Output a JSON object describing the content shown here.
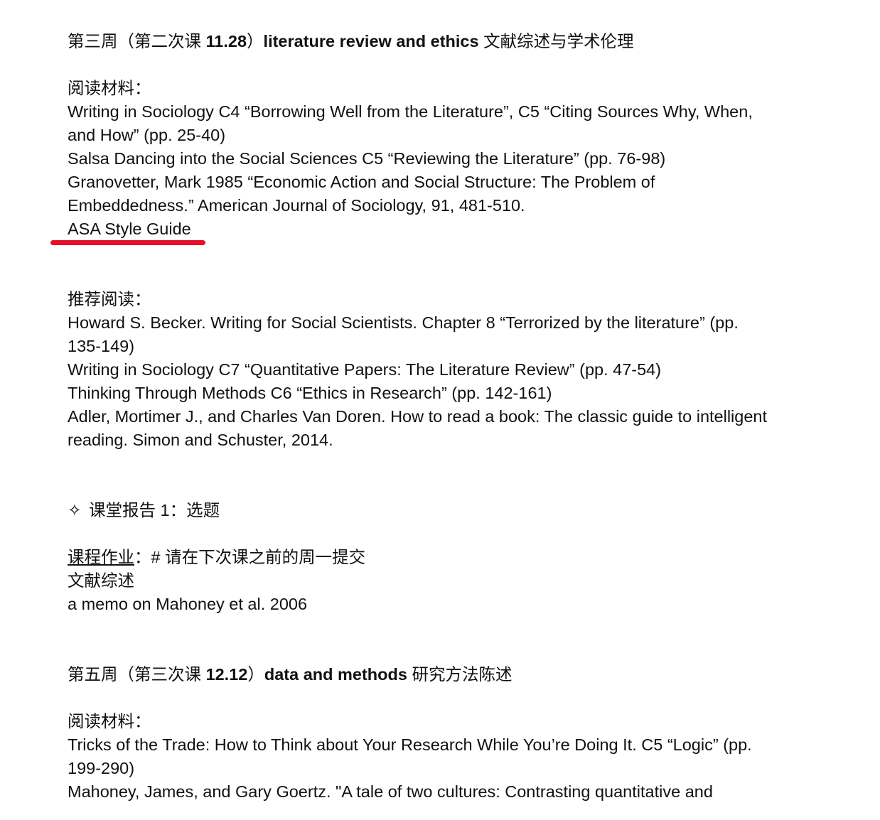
{
  "week3": {
    "title_prefix": "第三周（第二次课 ",
    "title_date": "11.28",
    "title_mid": "）",
    "title_en": "literature review and ethics",
    "title_cn": " 文献综述与学术伦理",
    "reading_label": "阅读材料：",
    "readings": [
      "Writing in Sociology C4 “Borrowing Well from the Literature”, C5 “Citing Sources Why, When,",
      "and How” (pp. 25-40)",
      "Salsa Dancing into the Social Sciences C5 “Reviewing the Literature” (pp. 76-98)",
      "Granovetter, Mark 1985 “Economic Action and Social Structure: The Problem of",
      "Embeddedness.” American Journal of Sociology, 91, 481-510."
    ],
    "highlighted_reading": "ASA Style Guide",
    "recommended_label": "推荐阅读：",
    "recommended": [
      "Howard S. Becker. Writing for Social Scientists. Chapter 8 “Terrorized by the literature” (pp.",
      "135-149)",
      "Writing in Sociology C7 “Quantitative Papers: The Literature Review” (pp. 47-54)",
      "Thinking Through Methods C6 “Ethics in Research” (pp. 142-161)",
      "Adler, Mortimer J., and Charles Van Doren. How to read a book: The classic guide to intelligent",
      "reading. Simon and Schuster, 2014."
    ],
    "report_bullet": "✧",
    "report_text": "课堂报告 1：选题",
    "homework_label": "课程作业",
    "homework_colon": "：",
    "homework_note": "# 请在下次课之前的周一提交",
    "homework_items": [
      "文献综述",
      "a memo on Mahoney et al. 2006"
    ]
  },
  "week5": {
    "title_prefix": "第五周（第三次课 ",
    "title_date": "12.12",
    "title_mid": "）",
    "title_en": "data and methods",
    "title_cn": " 研究方法陈述",
    "reading_label": "阅读材料：",
    "readings": [
      "Tricks of the Trade: How to Think about Your Research While You’re Doing It. C5 “Logic” (pp.",
      "199-290)",
      "Mahoney, James, and Gary Goertz. \"A tale of two cultures: Contrasting quantitative and"
    ]
  },
  "colors": {
    "text": "#111111",
    "highlight_underline": "#e5102a",
    "background": "#ffffff"
  }
}
